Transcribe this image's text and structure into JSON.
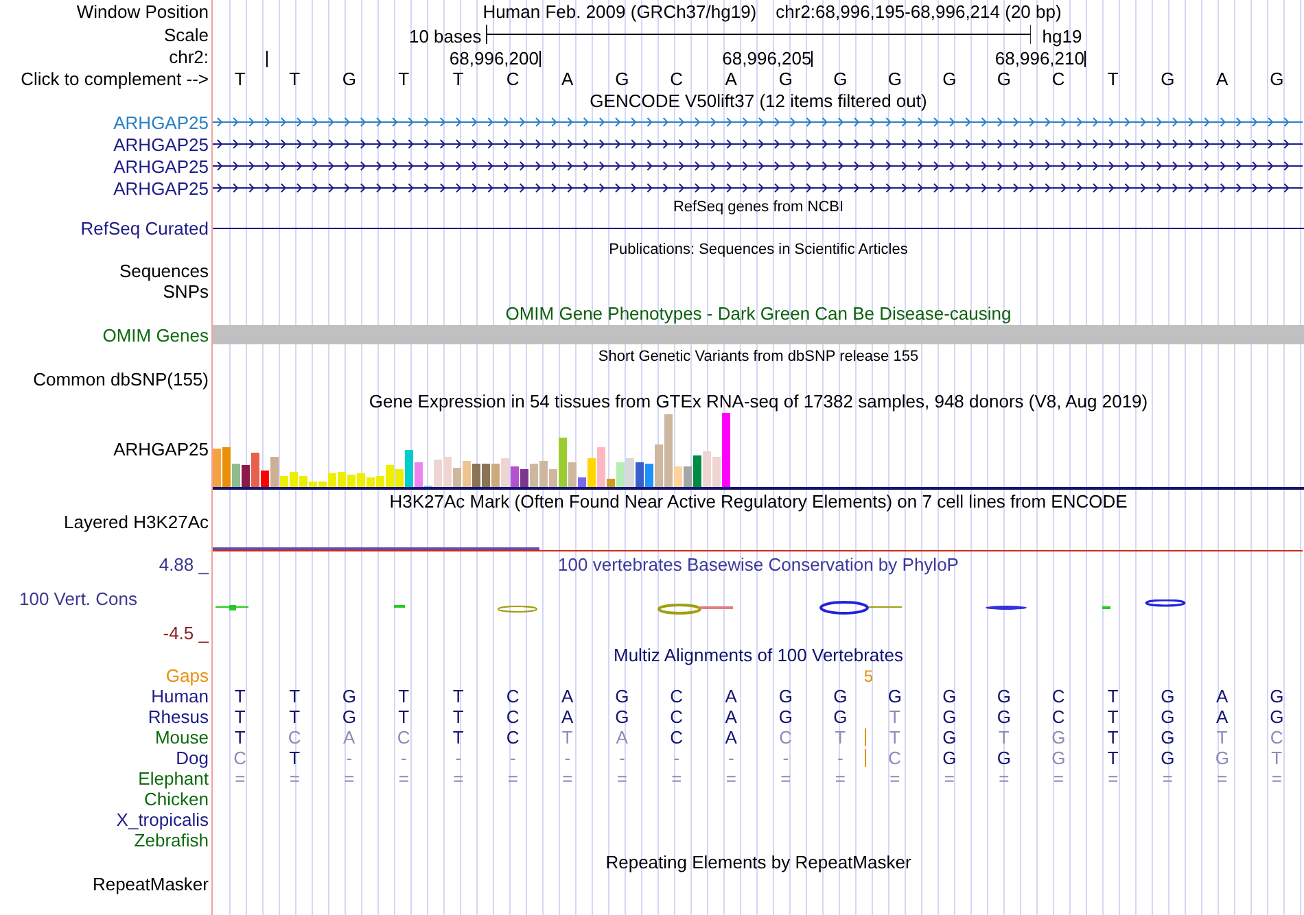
{
  "header": {
    "label": "Window Position",
    "assembly": "Human Feb. 2009 (GRCh37/hg19)",
    "position": "chr2:68,996,195-68,996,214 (20 bp)"
  },
  "scale": {
    "label": "Scale",
    "span": "10 bases",
    "assembly": "hg19"
  },
  "ruler": {
    "label": "chr2:",
    "ticks": [
      "68,996,200",
      "68,996,205",
      "68,996,210"
    ]
  },
  "bases": {
    "label": "Click to complement -->",
    "sequence": [
      "T",
      "T",
      "G",
      "T",
      "T",
      "C",
      "A",
      "G",
      "C",
      "A",
      "G",
      "G",
      "G",
      "G",
      "G",
      "C",
      "T",
      "G",
      "A",
      "G"
    ]
  },
  "gencode": {
    "title": "GENCODE V50lift37 (12 items filtered out)",
    "genes": [
      {
        "name": "ARHGAP25",
        "color": "#2a80c4"
      },
      {
        "name": "ARHGAP25",
        "color": "#1c1c88"
      },
      {
        "name": "ARHGAP25",
        "color": "#1c1c88"
      },
      {
        "name": "ARHGAP25",
        "color": "#1c1c88"
      }
    ]
  },
  "refseq": {
    "title": "RefSeq genes from NCBI",
    "label": "RefSeq Curated"
  },
  "publications": {
    "title": "Publications: Sequences in Scientific Articles",
    "labels": [
      "Sequences",
      "SNPs"
    ]
  },
  "omim": {
    "title": "OMIM Gene Phenotypes - Dark Green Can Be Disease-causing",
    "label": "OMIM Genes"
  },
  "dbsnp": {
    "title": "Short Genetic Variants from dbSNP release 155",
    "label": "Common dbSNP(155)"
  },
  "gtex": {
    "title": "Gene Expression in 54 tissues from GTEx RNA-seq of 17382 samples, 948 donors (V8, Aug 2019)",
    "label": "ARHGAP25"
  },
  "h3k27ac": {
    "title": "H3K27Ac Mark (Often Found Near Active Regulatory Elements) on 7 cell lines from ENCODE",
    "label": "Layered H3K27Ac"
  },
  "conservation": {
    "title": "100 vertebrates Basewise Conservation by PhyloP",
    "label": "100 Vert. Cons",
    "y_max": "4.88 _",
    "y_min": "-4.5 _"
  },
  "multiz": {
    "title": "Multiz Alignments of 100 Vertebrates",
    "gaps_label": "Gaps",
    "gap_count": "5",
    "species": [
      {
        "name": "Human",
        "color": "#1c1c88",
        "bases": [
          {
            "base": "T",
            "match": true
          },
          {
            "base": "T",
            "match": true
          },
          {
            "base": "G",
            "match": true
          },
          {
            "base": "T",
            "match": true
          },
          {
            "base": "T",
            "match": true
          },
          {
            "base": "C",
            "match": true
          },
          {
            "base": "A",
            "match": true
          },
          {
            "base": "G",
            "match": true
          },
          {
            "base": "C",
            "match": true
          },
          {
            "base": "A",
            "match": true
          },
          {
            "base": "G",
            "match": true
          },
          {
            "base": "G",
            "match": true
          },
          {
            "base": "G",
            "match": true
          },
          {
            "base": "G",
            "match": true
          },
          {
            "base": "G",
            "match": true
          },
          {
            "base": "C",
            "match": true
          },
          {
            "base": "T",
            "match": true
          },
          {
            "base": "G",
            "match": true
          },
          {
            "base": "A",
            "match": true
          },
          {
            "base": "G",
            "match": true
          }
        ]
      },
      {
        "name": "Rhesus",
        "color": "#1c1c88",
        "bases": [
          {
            "base": "T",
            "match": true
          },
          {
            "base": "T",
            "match": true
          },
          {
            "base": "G",
            "match": true
          },
          {
            "base": "T",
            "match": true
          },
          {
            "base": "T",
            "match": true
          },
          {
            "base": "C",
            "match": true
          },
          {
            "base": "A",
            "match": true
          },
          {
            "base": "G",
            "match": true
          },
          {
            "base": "C",
            "match": true
          },
          {
            "base": "A",
            "match": true
          },
          {
            "base": "G",
            "match": true
          },
          {
            "base": "G",
            "match": true
          },
          {
            "base": "T",
            "match": false
          },
          {
            "base": "G",
            "match": true
          },
          {
            "base": "G",
            "match": true
          },
          {
            "base": "C",
            "match": true
          },
          {
            "base": "T",
            "match": true
          },
          {
            "base": "G",
            "match": true
          },
          {
            "base": "A",
            "match": true
          },
          {
            "base": "G",
            "match": true
          }
        ]
      },
      {
        "name": "Mouse",
        "color": "#0e6a0e",
        "bases": [
          {
            "base": "T",
            "match": true
          },
          {
            "base": "C",
            "match": false
          },
          {
            "base": "A",
            "match": false
          },
          {
            "base": "C",
            "match": false
          },
          {
            "base": "T",
            "match": true
          },
          {
            "base": "C",
            "match": true
          },
          {
            "base": "T",
            "match": false
          },
          {
            "base": "A",
            "match": false
          },
          {
            "base": "C",
            "match": true
          },
          {
            "base": "A",
            "match": true
          },
          {
            "base": "C",
            "match": false
          },
          {
            "base": "T",
            "match": false
          },
          {
            "base": "T",
            "match": false,
            "gap_before": true
          },
          {
            "base": "G",
            "match": true
          },
          {
            "base": "T",
            "match": false
          },
          {
            "base": "G",
            "match": false
          },
          {
            "base": "T",
            "match": true
          },
          {
            "base": "G",
            "match": true
          },
          {
            "base": "T",
            "match": false
          },
          {
            "base": "C",
            "match": false
          }
        ]
      },
      {
        "name": "Dog",
        "color": "#1c1c88",
        "bases": [
          {
            "base": "C",
            "match": false
          },
          {
            "base": "T",
            "match": true
          },
          {
            "base": "-",
            "match": false
          },
          {
            "base": "-",
            "match": false
          },
          {
            "base": "-",
            "match": false
          },
          {
            "base": "-",
            "match": false
          },
          {
            "base": "-",
            "match": false
          },
          {
            "base": "-",
            "match": false
          },
          {
            "base": "-",
            "match": false
          },
          {
            "base": "-",
            "match": false
          },
          {
            "base": "-",
            "match": false
          },
          {
            "base": "-",
            "match": false
          },
          {
            "base": "C",
            "match": false,
            "gap_before": true
          },
          {
            "base": "G",
            "match": true
          },
          {
            "base": "G",
            "match": true
          },
          {
            "base": "G",
            "match": false
          },
          {
            "base": "T",
            "match": true
          },
          {
            "base": "G",
            "match": true
          },
          {
            "base": "G",
            "match": false
          },
          {
            "base": "T",
            "match": false
          }
        ]
      },
      {
        "name": "Elephant",
        "color": "#0e6a0e",
        "bases": [
          {
            "base": "=",
            "match": false
          },
          {
            "base": "=",
            "match": false
          },
          {
            "base": "=",
            "match": false
          },
          {
            "base": "=",
            "match": false
          },
          {
            "base": "=",
            "match": false
          },
          {
            "base": "=",
            "match": false
          },
          {
            "base": "=",
            "match": false
          },
          {
            "base": "=",
            "match": false
          },
          {
            "base": "=",
            "match": false
          },
          {
            "base": "=",
            "match": false
          },
          {
            "base": "=",
            "match": false
          },
          {
            "base": "=",
            "match": false
          },
          {
            "base": "=",
            "match": false
          },
          {
            "base": "=",
            "match": false
          },
          {
            "base": "=",
            "match": false
          },
          {
            "base": "=",
            "match": false
          },
          {
            "base": "=",
            "match": false
          },
          {
            "base": "=",
            "match": false
          },
          {
            "base": "=",
            "match": false
          },
          {
            "base": "=",
            "match": false
          }
        ]
      },
      {
        "name": "Chicken",
        "color": "#0e6a0e"
      },
      {
        "name": "X_tropicalis",
        "color": "#1c1c88"
      },
      {
        "name": "Zebrafish",
        "color": "#0e6a0e"
      }
    ]
  },
  "repeatmasker": {
    "title": "Repeating Elements by RepeatMasker",
    "label": "RepeatMasker"
  }
}
